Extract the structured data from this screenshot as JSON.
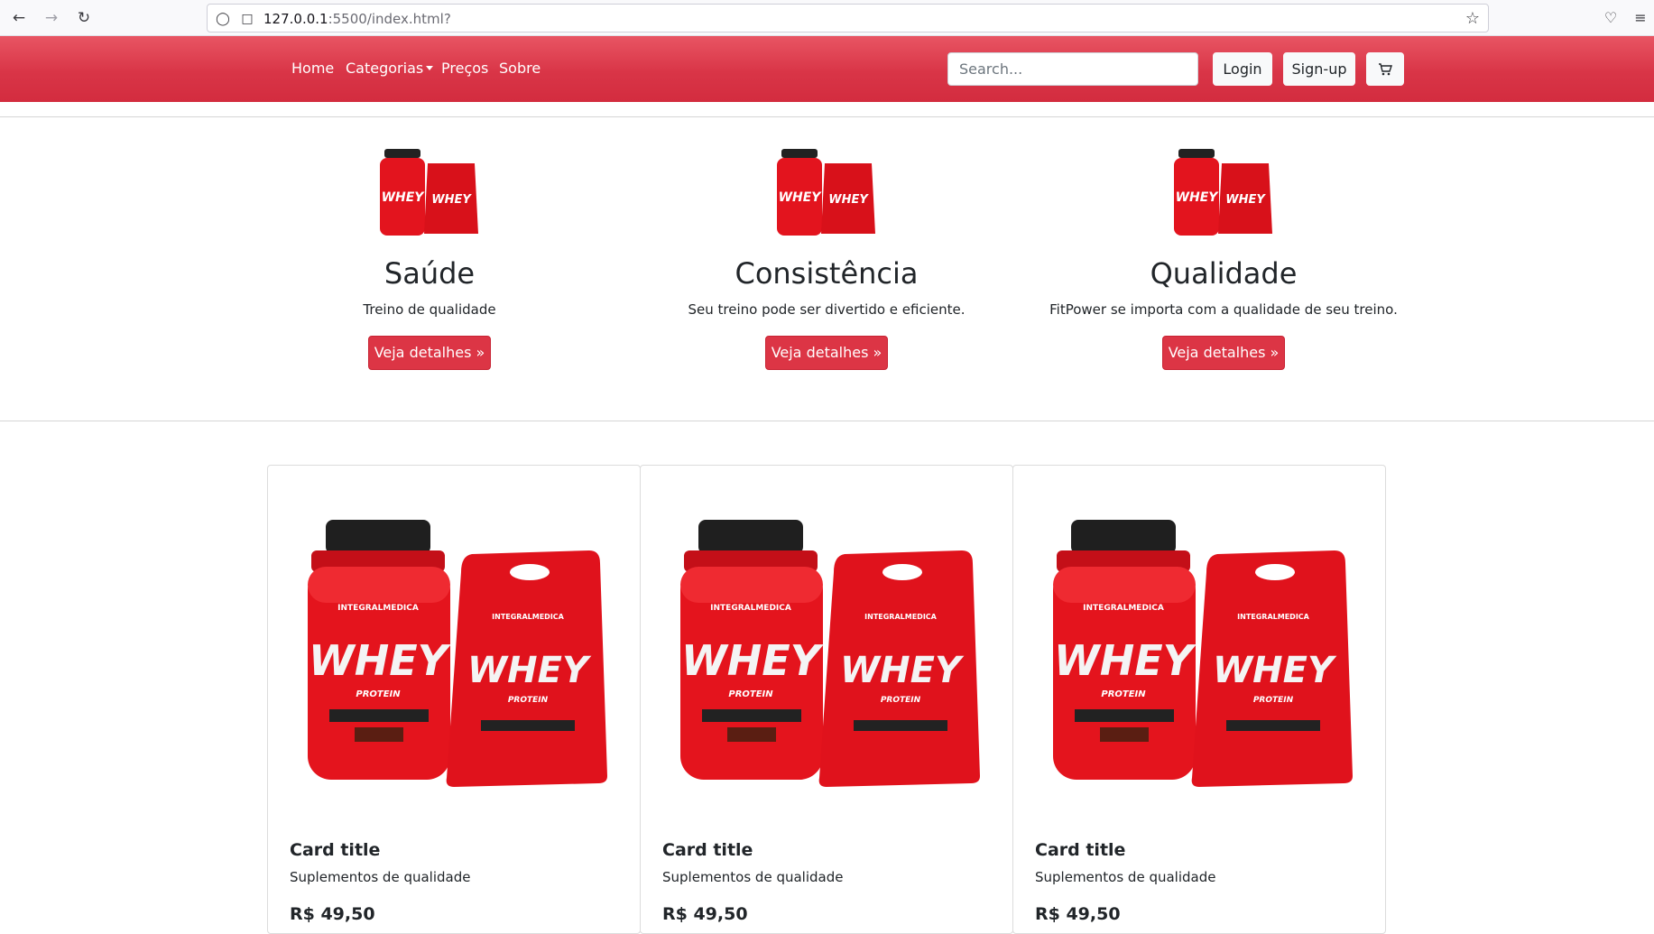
{
  "browser": {
    "url_host": "127.0.0.1",
    "url_rest": ":5500/index.html?"
  },
  "navbar": {
    "links": [
      "Home",
      "Categorias",
      "Preços",
      "Sobre"
    ],
    "search_placeholder": "Search...",
    "login_label": "Login",
    "signup_label": "Sign-up",
    "accent_color": "#dc3545"
  },
  "features": [
    {
      "title": "Saúde",
      "text": "Treino de qualidade",
      "button": "Veja detalhes »",
      "label_small": "WHEY"
    },
    {
      "title": "Consistência",
      "text": "Seu treino pode ser divertido e eficiente.",
      "button": "Veja detalhes »",
      "label_small": "WHEY"
    },
    {
      "title": "Qualidade",
      "text": "FitPower se importa com a qualidade de seu treino.",
      "button": "Veja detalhes »",
      "label_small": "WHEY"
    }
  ],
  "cards": [
    {
      "title": "Card title",
      "text": "Suplementos de qualidade",
      "price": "R$ 49,50",
      "brand": "INTEGRALMEDICA",
      "label_big": "WHEY",
      "label_sub": "PROTEIN"
    },
    {
      "title": "Card title",
      "text": "Suplementos de qualidade",
      "price": "R$ 49,50",
      "brand": "INTEGRALMEDICA",
      "label_big": "WHEY",
      "label_sub": "PROTEIN"
    },
    {
      "title": "Card title",
      "text": "Suplementos de qualidade",
      "price": "R$ 49,50",
      "brand": "INTEGRALMEDICA",
      "label_big": "WHEY",
      "label_sub": "PROTEIN"
    }
  ]
}
